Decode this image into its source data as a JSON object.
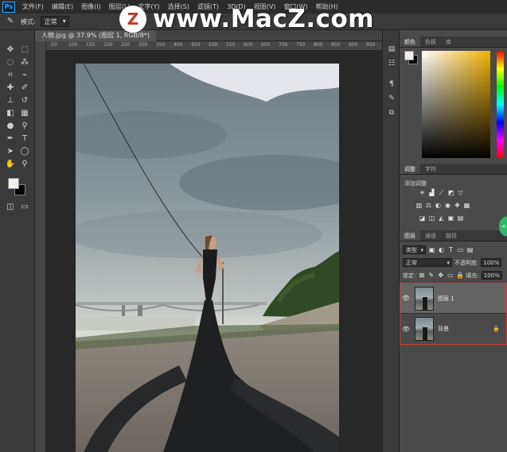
{
  "app": {
    "logo": "Ps"
  },
  "menu": [
    "文件(F)",
    "编辑(E)",
    "图像(I)",
    "图层(L)",
    "文字(Y)",
    "选择(S)",
    "滤镜(T)",
    "3D(D)",
    "视图(V)",
    "窗口(W)",
    "帮助(H)"
  ],
  "options": {
    "mode_label": "模式:",
    "mode_value": "正常"
  },
  "watermark": {
    "logo": "Z",
    "text": "www.MacZ.com"
  },
  "document": {
    "tab_title": "人物.jpg @ 37.9% (图层 1, RGB/8*)"
  },
  "ruler": {
    "ticks": [
      "50",
      "100",
      "150",
      "200",
      "250",
      "300",
      "350",
      "400",
      "450",
      "500",
      "550",
      "600",
      "650",
      "700",
      "750",
      "800",
      "850",
      "900",
      "950"
    ]
  },
  "tools": [
    "move-icon",
    "marquee-icon",
    "lasso-icon",
    "magic-wand-icon",
    "crop-icon",
    "eyedropper-icon",
    "healing-icon",
    "brush-icon",
    "stamp-icon",
    "history-brush-icon",
    "eraser-icon",
    "gradient-icon",
    "blur-icon",
    "dodge-icon",
    "pen-icon",
    "type-icon",
    "path-select-icon",
    "shape-icon",
    "hand-icon",
    "zoom-icon"
  ],
  "colors": {
    "foreground": "#f2efe8",
    "background": "#000000",
    "selection_border": "#d23a3a"
  },
  "panels": {
    "color": {
      "tabs": [
        "颜色",
        "色板",
        "库"
      ]
    },
    "adjust": {
      "tabs": [
        "调整",
        "字符"
      ],
      "title": "添加调整"
    },
    "layers": {
      "tabs": [
        "图层",
        "通道",
        "路径"
      ],
      "filter_label": "类型",
      "blend_mode": "正常",
      "opacity_label": "不透明度:",
      "opacity_value": "100%",
      "lock_label": "锁定:",
      "fill_label": "填充:",
      "fill_value": "100%",
      "items": [
        {
          "name": "图层 1",
          "selected": true
        },
        {
          "name": "背景",
          "locked": true
        }
      ]
    }
  },
  "side_widget": {
    "label": "<<"
  }
}
